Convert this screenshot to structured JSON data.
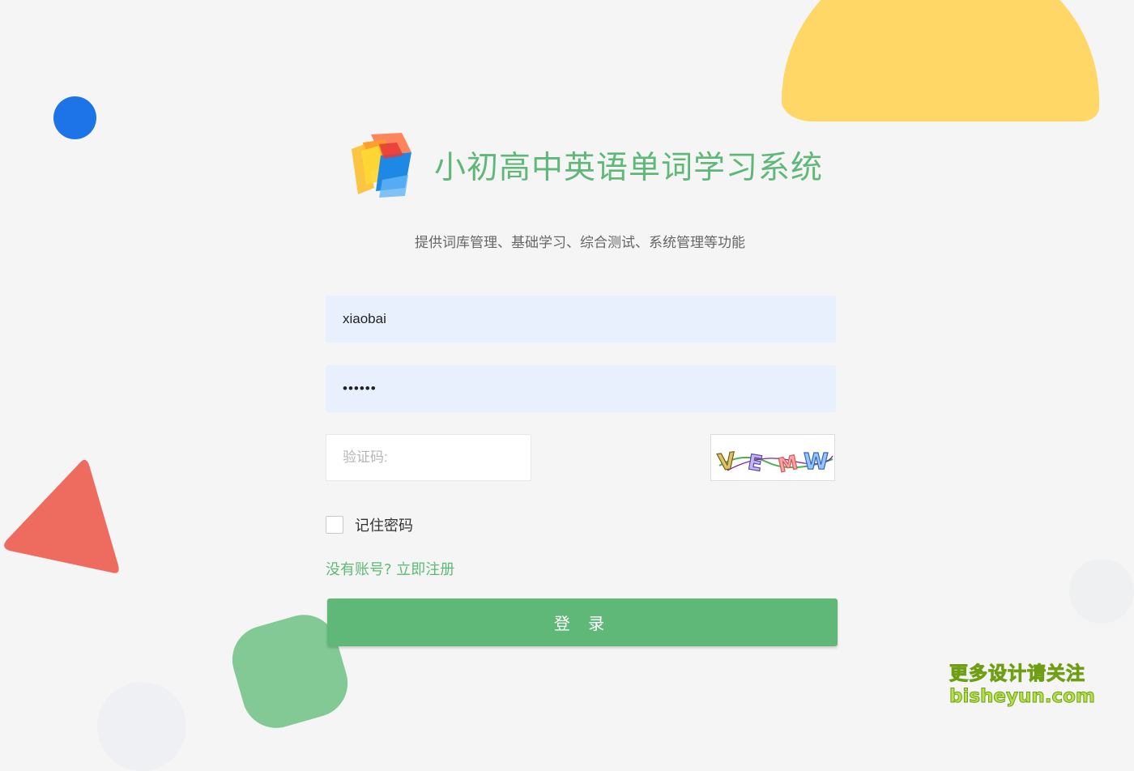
{
  "app": {
    "title": "小初高中英语单词学习系统",
    "subtitle": "提供词库管理、基础学习、综合测试、系统管理等功能"
  },
  "login_form": {
    "username_value": "xiaobai",
    "password_value": "••••••",
    "captcha_placeholder": "验证码:",
    "captcha_text": "VEMW",
    "remember_label": "记住密码",
    "register_link": "没有账号? 立即注册",
    "login_button": "登 录"
  },
  "watermark": {
    "line1": "更多设计请关注",
    "line2": "bisheyun.com"
  },
  "colors": {
    "accent": "#5fb878",
    "input_fill": "#e8f0fe",
    "background": "#f5f5f5",
    "yellow_shape": "#fed766",
    "blue_dot": "#1d74e8",
    "red_triangle": "#ee6b60",
    "green_shape": "#83c995"
  }
}
